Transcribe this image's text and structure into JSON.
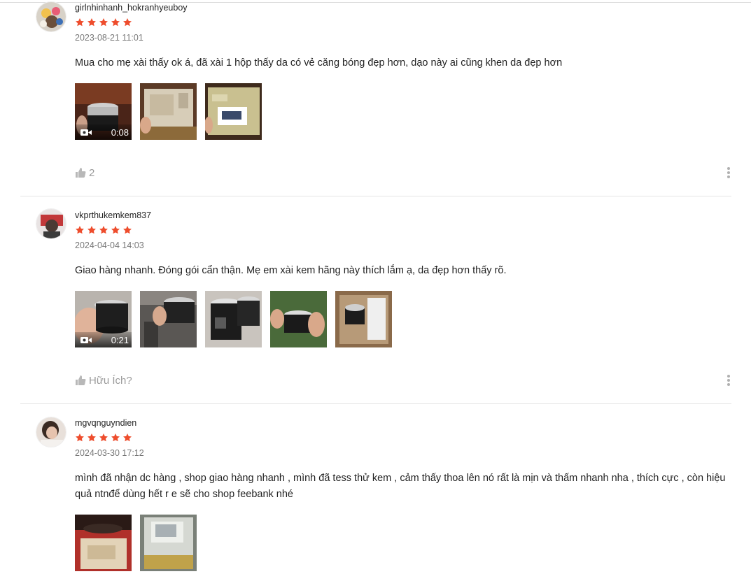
{
  "reviews": [
    {
      "username": "girlnhinhanh_hokranhyeuboy",
      "rating": 5,
      "time": "2023-08-21 11:01",
      "content": "Mua cho mẹ xài thấy ok á, đã xài 1 hộp thấy da có vẻ căng bóng đẹp hơn, dạo này ai cũng khen da đẹp hơn",
      "video_duration": "0:08",
      "likes": "2"
    },
    {
      "username": "vkprthukemkem837",
      "rating": 5,
      "time": "2024-04-04 14:03",
      "content": "Giao hàng nhanh. Đóng gói cẩn thận. Mẹ em xài kem hãng này thích lắm ạ, da đẹp hơn thấy rõ.",
      "video_duration": "0:21",
      "likes": "Hữu Ích?"
    },
    {
      "username": "mgvqnguyndien",
      "rating": 5,
      "time": "2024-03-30 17:12",
      "content": "mình đã nhận dc hàng , shop giao hàng nhanh , mình đã tess thử kem , cảm thấy thoa lên nó rất là mịn và thấm nhanh nha , thích cực , còn hiệu quả ntnđể dùng hết r e sẽ cho shop feebank nhé"
    }
  ],
  "colors": {
    "star": "#ee4d2d",
    "muted_text": "#8a8a8a",
    "divider": "#e5e5e5"
  }
}
